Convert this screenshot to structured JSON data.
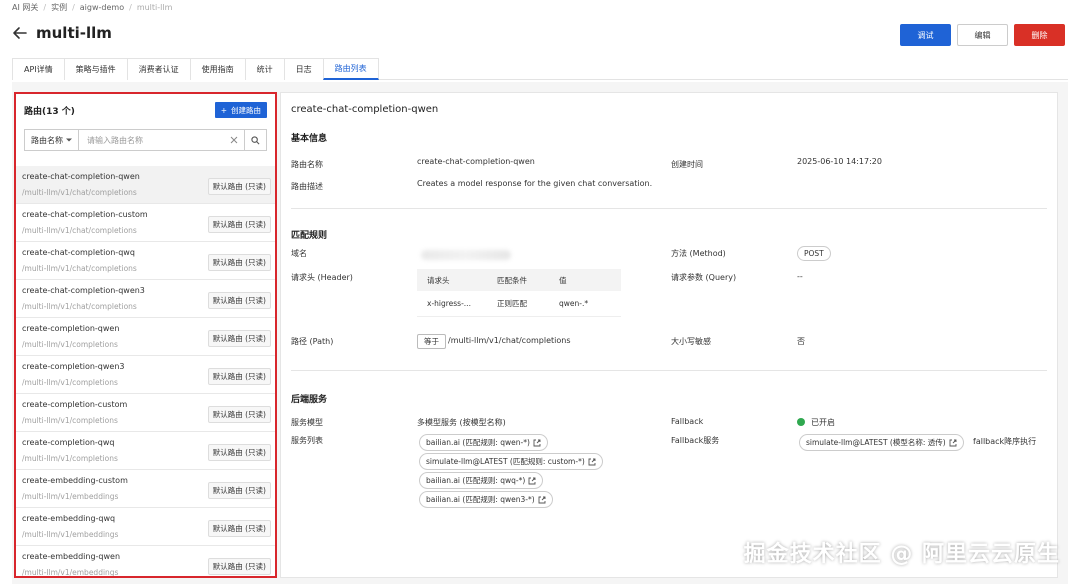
{
  "breadcrumb": [
    "AI 网关",
    "实例",
    "aigw-demo",
    "multi-llm"
  ],
  "page_title": "multi-llm",
  "actions": {
    "debug": "调试",
    "edit": "编辑",
    "delete": "删除"
  },
  "tabs": [
    {
      "label": "API详情",
      "active": false
    },
    {
      "label": "策略与插件",
      "active": false
    },
    {
      "label": "消费者认证",
      "active": false
    },
    {
      "label": "使用指南",
      "active": false
    },
    {
      "label": "统计",
      "active": false
    },
    {
      "label": "日志",
      "active": false
    },
    {
      "label": "路由列表",
      "active": true
    }
  ],
  "left": {
    "title": "路由(13 个)",
    "create_label": "创建路由",
    "search_select": "路由名称",
    "search_placeholder": "请输入路由名称",
    "routes": [
      {
        "name": "create-chat-completion-qwen",
        "path": "/multi-llm/v1/chat/completions",
        "tag": "默认路由 (只读)",
        "selected": true
      },
      {
        "name": "create-chat-completion-custom",
        "path": "/multi-llm/v1/chat/completions",
        "tag": "默认路由 (只读)"
      },
      {
        "name": "create-chat-completion-qwq",
        "path": "/multi-llm/v1/chat/completions",
        "tag": "默认路由 (只读)"
      },
      {
        "name": "create-chat-completion-qwen3",
        "path": "/multi-llm/v1/chat/completions",
        "tag": "默认路由 (只读)"
      },
      {
        "name": "create-completion-qwen",
        "path": "/multi-llm/v1/completions",
        "tag": "默认路由 (只读)"
      },
      {
        "name": "create-completion-qwen3",
        "path": "/multi-llm/v1/completions",
        "tag": "默认路由 (只读)"
      },
      {
        "name": "create-completion-custom",
        "path": "/multi-llm/v1/completions",
        "tag": "默认路由 (只读)"
      },
      {
        "name": "create-completion-qwq",
        "path": "/multi-llm/v1/completions",
        "tag": "默认路由 (只读)"
      },
      {
        "name": "create-embedding-custom",
        "path": "/multi-llm/v1/embeddings",
        "tag": "默认路由 (只读)"
      },
      {
        "name": "create-embedding-qwq",
        "path": "/multi-llm/v1/embeddings",
        "tag": "默认路由 (只读)"
      },
      {
        "name": "create-embedding-qwen",
        "path": "/multi-llm/v1/embeddings",
        "tag": "默认路由 (只读)"
      }
    ]
  },
  "detail": {
    "title": "create-chat-completion-qwen",
    "basic": {
      "section": "基本信息",
      "name_label": "路由名称",
      "name_value": "create-chat-completion-qwen",
      "desc_label": "路由描述",
      "desc_value": "Creates a model response for the given chat conversation.",
      "created_label": "创建时间",
      "created_value": "2025-06-10 14:17:20"
    },
    "match": {
      "section": "匹配规则",
      "domain_label": "域名",
      "method_label": "方法 (Method)",
      "method_value": "POST",
      "header_label": "请求头 (Header)",
      "header_table": {
        "cols": [
          "请求头",
          "匹配条件",
          "值"
        ],
        "row": [
          "x-higress-...",
          "正则匹配",
          "qwen-.*"
        ]
      },
      "query_label": "请求参数 (Query)",
      "query_value": "--",
      "path_label": "路径 (Path)",
      "path_op": "等于",
      "path_value": "/multi-llm/v1/chat/completions",
      "case_label": "大小写敏感",
      "case_value": "否"
    },
    "backend": {
      "section": "后端服务",
      "mode_label": "服务模型",
      "mode_value": "多模型服务 (按模型名称)",
      "list_label": "服务列表",
      "services": [
        "bailian.ai (匹配规则: qwen-*)",
        "simulate-llm@LATEST (匹配规则: custom-*)",
        "bailian.ai (匹配规则: qwq-*)",
        "bailian.ai (匹配规则: qwen3-*)"
      ],
      "fallback_label": "Fallback",
      "fallback_value": "已开启",
      "fallback_service_label": "Fallback服务",
      "fallback_service": "simulate-llm@LATEST (模型名称: 透传)",
      "fallback_note": "fallback降序执行"
    }
  },
  "watermark": "掘金技术社区 @ 阿里云云原生",
  "colors": {
    "primary": "#1f63d6",
    "danger": "#d93026",
    "highlight_border": "#d8262c",
    "success": "#2fa84f"
  }
}
